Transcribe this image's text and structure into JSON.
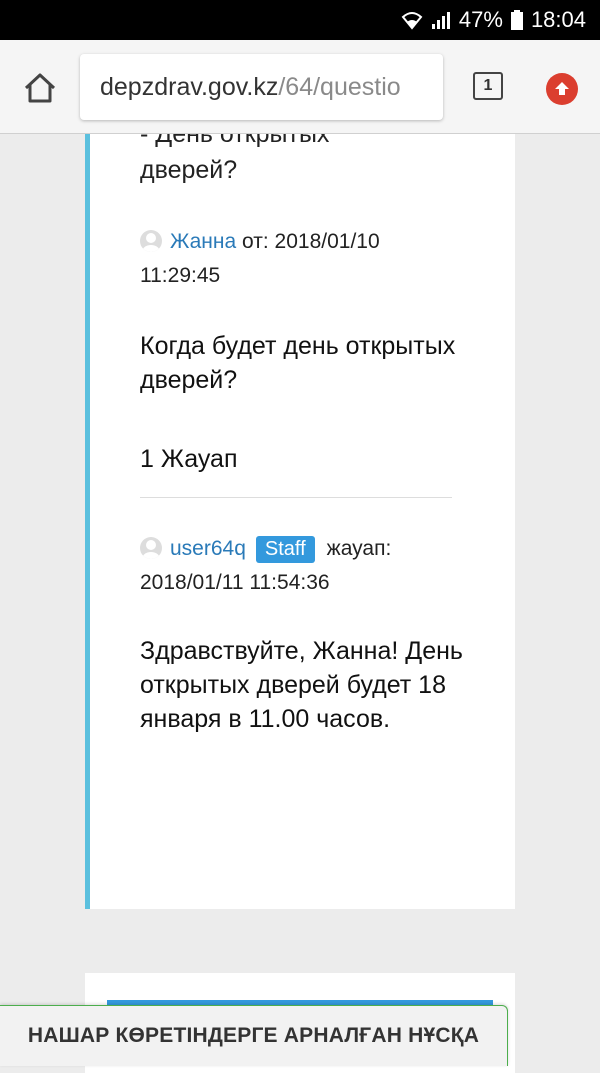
{
  "statusbar": {
    "battery": "47%",
    "time": "18:04"
  },
  "browser": {
    "url_domain": "depzdrav.gov.kz",
    "url_path": "/64/questio",
    "tab_count": "1",
    "accent_color": "#db3e2f"
  },
  "question": {
    "title_tail": "дверей?",
    "title_cut": "- День открытых",
    "author": "Жанна",
    "date_prefix": "от: 2018/01/10",
    "time": "11:29:45",
    "text": " Когда будет день открытых дверей?",
    "answers_count": "1 Жауап"
  },
  "answer": {
    "author": "user64q",
    "badge": "Staff",
    "verb": "жауап:",
    "datetime": "2018/01/11 11:54:36",
    "text": "Здравствуйте, Жанна! День открытых дверей будет 18 января в 11.00 часов."
  },
  "accessibility": {
    "label": "НАШАР КӨРЕТІНДЕРГЕ АРНАЛҒАН НҰСҚА"
  },
  "colors": {
    "accent_bar": "#5bc0de",
    "link": "#2a7ab8",
    "staff_badge": "#3399dd"
  }
}
